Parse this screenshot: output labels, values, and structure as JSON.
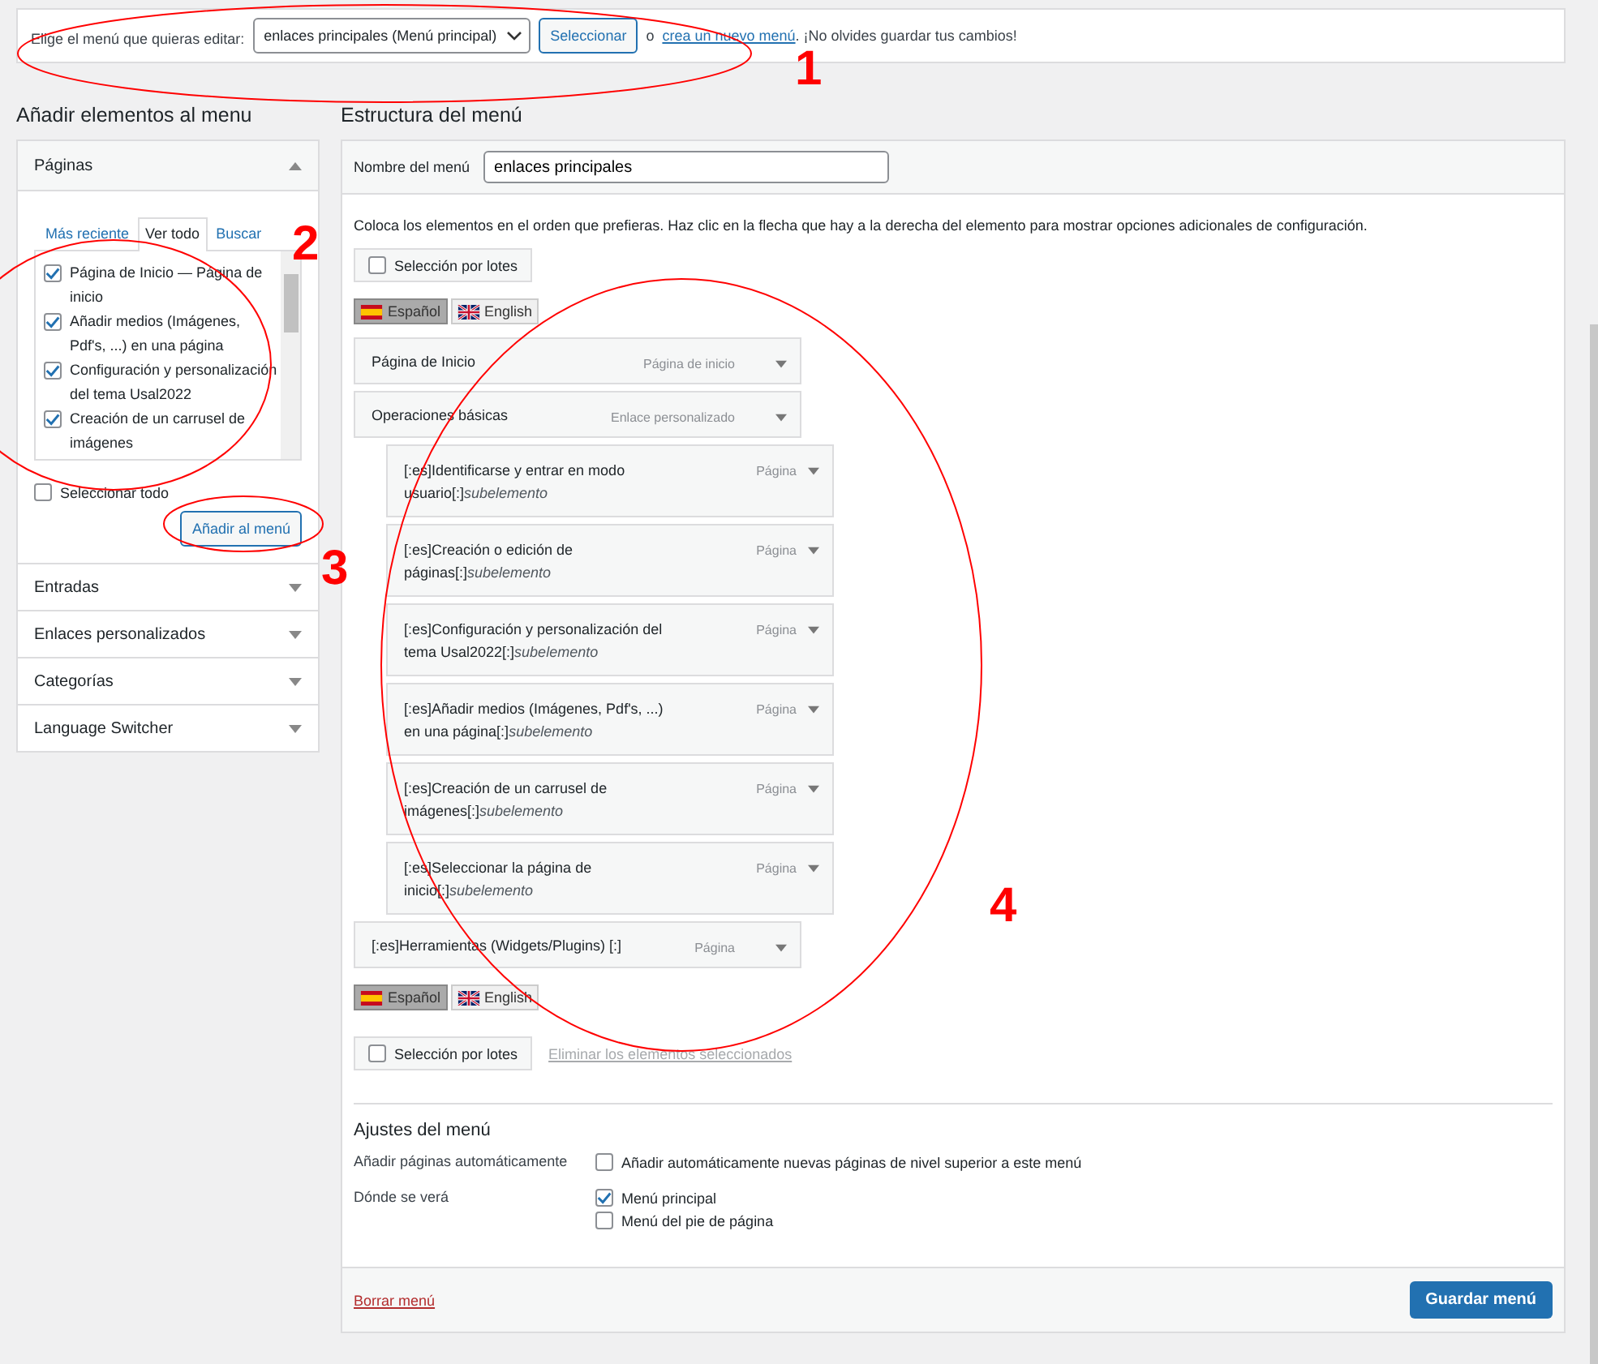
{
  "top_bar": {
    "label": "Elige el menú que quieras editar:",
    "menu_select": "enlaces principales (Menú principal)",
    "select_button": "Seleccionar",
    "or_text": "o",
    "create_link": "crea un nuevo menú",
    "reminder": ". ¡No olvides guardar tus cambios!"
  },
  "left": {
    "heading": "Añadir elementos al menu",
    "pages_box": {
      "title": "Páginas",
      "expanded": true,
      "tabs": [
        {
          "label": "Más reciente",
          "selected": false
        },
        {
          "label": "Ver todo",
          "selected": true
        },
        {
          "label": "Buscar",
          "selected": false
        }
      ],
      "pages": [
        {
          "label": "Página de Inicio — Página de inicio",
          "checked": true
        },
        {
          "label": "Añadir medios (Imágenes, Pdf's, ...) en una página",
          "checked": true
        },
        {
          "label": "Configuración y personalización del tema Usal2022",
          "checked": true
        },
        {
          "label": "Creación de un carrusel de imágenes",
          "checked": true
        }
      ],
      "select_all": {
        "label": "Seleccionar todo",
        "checked": false
      },
      "add_button": "Añadir al menú"
    },
    "sections": [
      {
        "title": "Entradas",
        "expanded": false
      },
      {
        "title": "Enlaces personalizados",
        "expanded": false
      },
      {
        "title": "Categorías",
        "expanded": false
      },
      {
        "title": "Language Switcher",
        "expanded": false
      }
    ]
  },
  "right": {
    "heading": "Estructura del menú",
    "name_label": "Nombre del menú",
    "name_value": "enlaces principales",
    "instructions": "Coloca los elementos en el orden que prefieras. Haz clic en la flecha que hay a la derecha del elemento para mostrar opciones adicionales de configuración.",
    "bulk_top": {
      "label": "Selección por lotes",
      "checked": false
    },
    "languages_top": [
      {
        "label": "Español",
        "kind": "es",
        "selected": true
      },
      {
        "label": "English",
        "kind": "gb",
        "selected": false
      }
    ],
    "items": [
      {
        "title": "Página de Inicio",
        "type": "Página de inicio"
      },
      {
        "title": "Operaciones básicas",
        "type": "Enlace personalizado",
        "children": [
          {
            "title": "[:es]Identificarse y entrar en modo usuario[:]",
            "note": "subelemento",
            "type": "Página"
          },
          {
            "title": "[:es]Creación o edición de páginas[:]",
            "note": "subelemento",
            "type": "Página"
          },
          {
            "title": "[:es]Configuración y personalización del tema Usal2022[:]",
            "note": "subelemento",
            "type": "Página"
          },
          {
            "title": "[:es]Añadir medios (Imágenes, Pdf's, ...) en una página[:]",
            "note": "subelemento",
            "type": "Página"
          },
          {
            "title": "[:es]Creación de un carrusel de imágenes[:]",
            "note": "subelemento",
            "type": "Página"
          },
          {
            "title": "[:es]Seleccionar la página de inicio[:]",
            "note": "subelemento",
            "type": "Página"
          }
        ]
      },
      {
        "title": "[:es]Herramientas (Widgets/Plugins) [:]",
        "type": "Página"
      }
    ],
    "languages_bottom": [
      {
        "label": "Español",
        "kind": "es",
        "selected": true
      },
      {
        "label": "English",
        "kind": "gb",
        "selected": false
      }
    ],
    "bulk_bottom": {
      "label": "Selección por lotes",
      "checked": false
    },
    "delete_selected": "Eliminar los elementos seleccionados",
    "settings": {
      "title": "Ajustes del menú",
      "rows": [
        {
          "label": "Añadir páginas automáticamente",
          "options": [
            {
              "label": "Añadir automáticamente nuevas páginas de nivel superior a este menú",
              "checked": false
            }
          ]
        },
        {
          "label": "Dónde se verá",
          "options": [
            {
              "label": "Menú principal",
              "checked": true
            },
            {
              "label": "Menú del pie de página",
              "checked": false
            }
          ]
        }
      ]
    },
    "delete_menu": "Borrar menú",
    "save_button": "Guardar menú"
  },
  "annotations": [
    {
      "label": "1"
    },
    {
      "label": "2"
    },
    {
      "label": "3"
    },
    {
      "label": "4"
    }
  ]
}
